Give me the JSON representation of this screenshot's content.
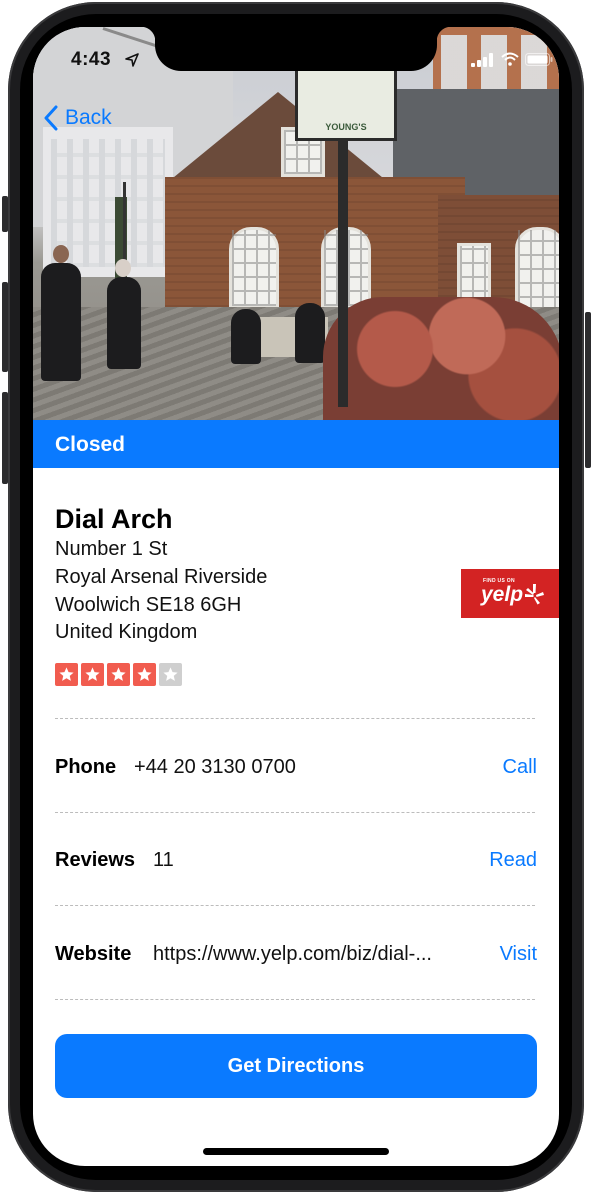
{
  "status_bar": {
    "time": "4:43"
  },
  "nav": {
    "back_label": "Back"
  },
  "hero": {
    "sign_text": "YOUNG'S"
  },
  "banner": {
    "status": "Closed",
    "color": "#0a7aff"
  },
  "business": {
    "name": "Dial Arch",
    "address_lines": [
      "Number 1 St",
      "Royal Arsenal Riverside",
      "Woolwich SE18 6GH",
      "United Kingdom"
    ],
    "rating": 4,
    "rating_max": 5,
    "star_color": "#f15c4f"
  },
  "yelp_badge": {
    "small_text": "FIND US ON",
    "word": "yelp"
  },
  "rows": {
    "phone": {
      "label": "Phone",
      "value": "+44 20 3130 0700",
      "action": "Call"
    },
    "reviews": {
      "label": "Reviews",
      "value": "11",
      "action": "Read"
    },
    "website": {
      "label": "Website",
      "value": "https://www.yelp.com/biz/dial-...",
      "action": "Visit"
    }
  },
  "cta": {
    "label": "Get Directions"
  },
  "colors": {
    "accent": "#0a7aff",
    "yelp_red": "#d32323"
  }
}
